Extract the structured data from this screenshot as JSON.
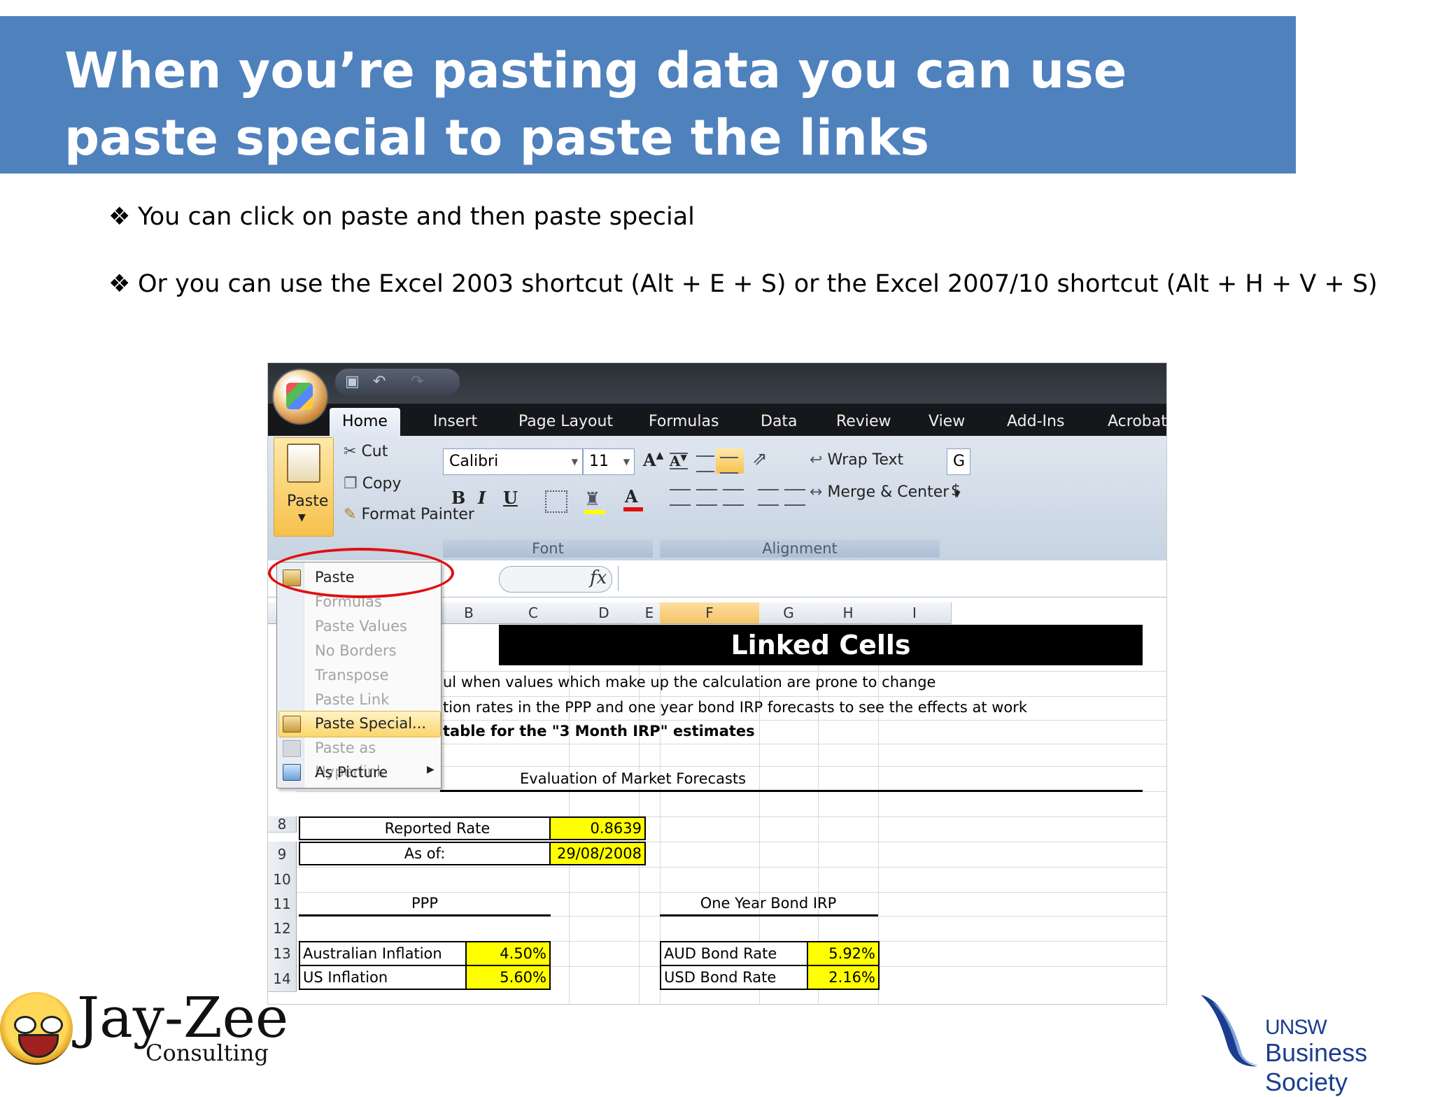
{
  "slide": {
    "title": "When you’re pasting data you can use paste special to paste the links",
    "bullet_glyph": "❖",
    "bullets": [
      "You can click on paste and then paste special",
      "Or you can use the Excel 2003 shortcut (Alt + E + S) or the Excel 2007/10 shortcut (Alt + H + V + S)"
    ]
  },
  "excel": {
    "tabs": [
      "Home",
      "Insert",
      "Page Layout",
      "Formulas",
      "Data",
      "Review",
      "View",
      "Add-Ins",
      "Acrobat"
    ],
    "clipboard": {
      "paste": "Paste",
      "cut": "Cut",
      "copy": "Copy",
      "format_painter": "Format Painter"
    },
    "font": {
      "name": "Calibri",
      "size": "11",
      "group_label": "Font"
    },
    "alignment": {
      "wrap_text": "Wrap Text",
      "merge_center": "Merge & Center",
      "group_label": "Alignment"
    },
    "number_stub": {
      "top": "G",
      "bottom": "$"
    },
    "formula_fx": "fx",
    "columns": [
      "B",
      "C",
      "D",
      "E",
      "F",
      "G",
      "H",
      "I"
    ],
    "rows": [
      "8",
      "9",
      "10",
      "11",
      "12",
      "13",
      "14"
    ],
    "paste_menu": [
      {
        "label": "Paste",
        "disabled": false
      },
      {
        "label": "Formulas",
        "disabled": true
      },
      {
        "label": "Paste Values",
        "disabled": true
      },
      {
        "label": "No Borders",
        "disabled": true
      },
      {
        "label": "Transpose",
        "disabled": true
      },
      {
        "label": "Paste Link",
        "disabled": true
      },
      {
        "label": "Paste Special...",
        "disabled": false,
        "highlighted": true
      },
      {
        "label": "Paste as Hyperlink",
        "disabled": true
      },
      {
        "label": "As Picture",
        "disabled": false,
        "submenu": true
      }
    ],
    "sheet": {
      "banner": "Linked Cells",
      "line1": "ul when values which make up the calculation are prone to change",
      "line2": "tion rates in the PPP and one year bond IRP forecasts to see the effects at work",
      "line3": "table for the \"3 Month IRP\" estimates",
      "section_title": "Evaluation of Market Forecasts",
      "reported_rate_label": "Reported Rate",
      "reported_rate_value": "0.8639",
      "as_of_label": "As of:",
      "as_of_value": "29/08/2008",
      "ppp_title": "PPP",
      "bond_title": "One Year Bond IRP",
      "aus_inflation_label": "Australian Inflation",
      "aus_inflation_value": "4.50%",
      "us_inflation_label": "US Inflation",
      "us_inflation_value": "5.60%",
      "aud_bond_label": "AUD Bond Rate",
      "aud_bond_value": "5.92%",
      "usd_bond_label": "USD Bond Rate",
      "usd_bond_value": "2.16%"
    }
  },
  "logos": {
    "jayzee_name": "Jay-Zee",
    "jayzee_sub": "Consulting",
    "unsw_top": "UNSW",
    "unsw_bottom": "Business Society"
  },
  "colors": {
    "banner": "#4f81bd",
    "highlight_yellow": "#ffff00",
    "oval_red": "#e01010",
    "unsw_blue": "#1a3d8f"
  }
}
